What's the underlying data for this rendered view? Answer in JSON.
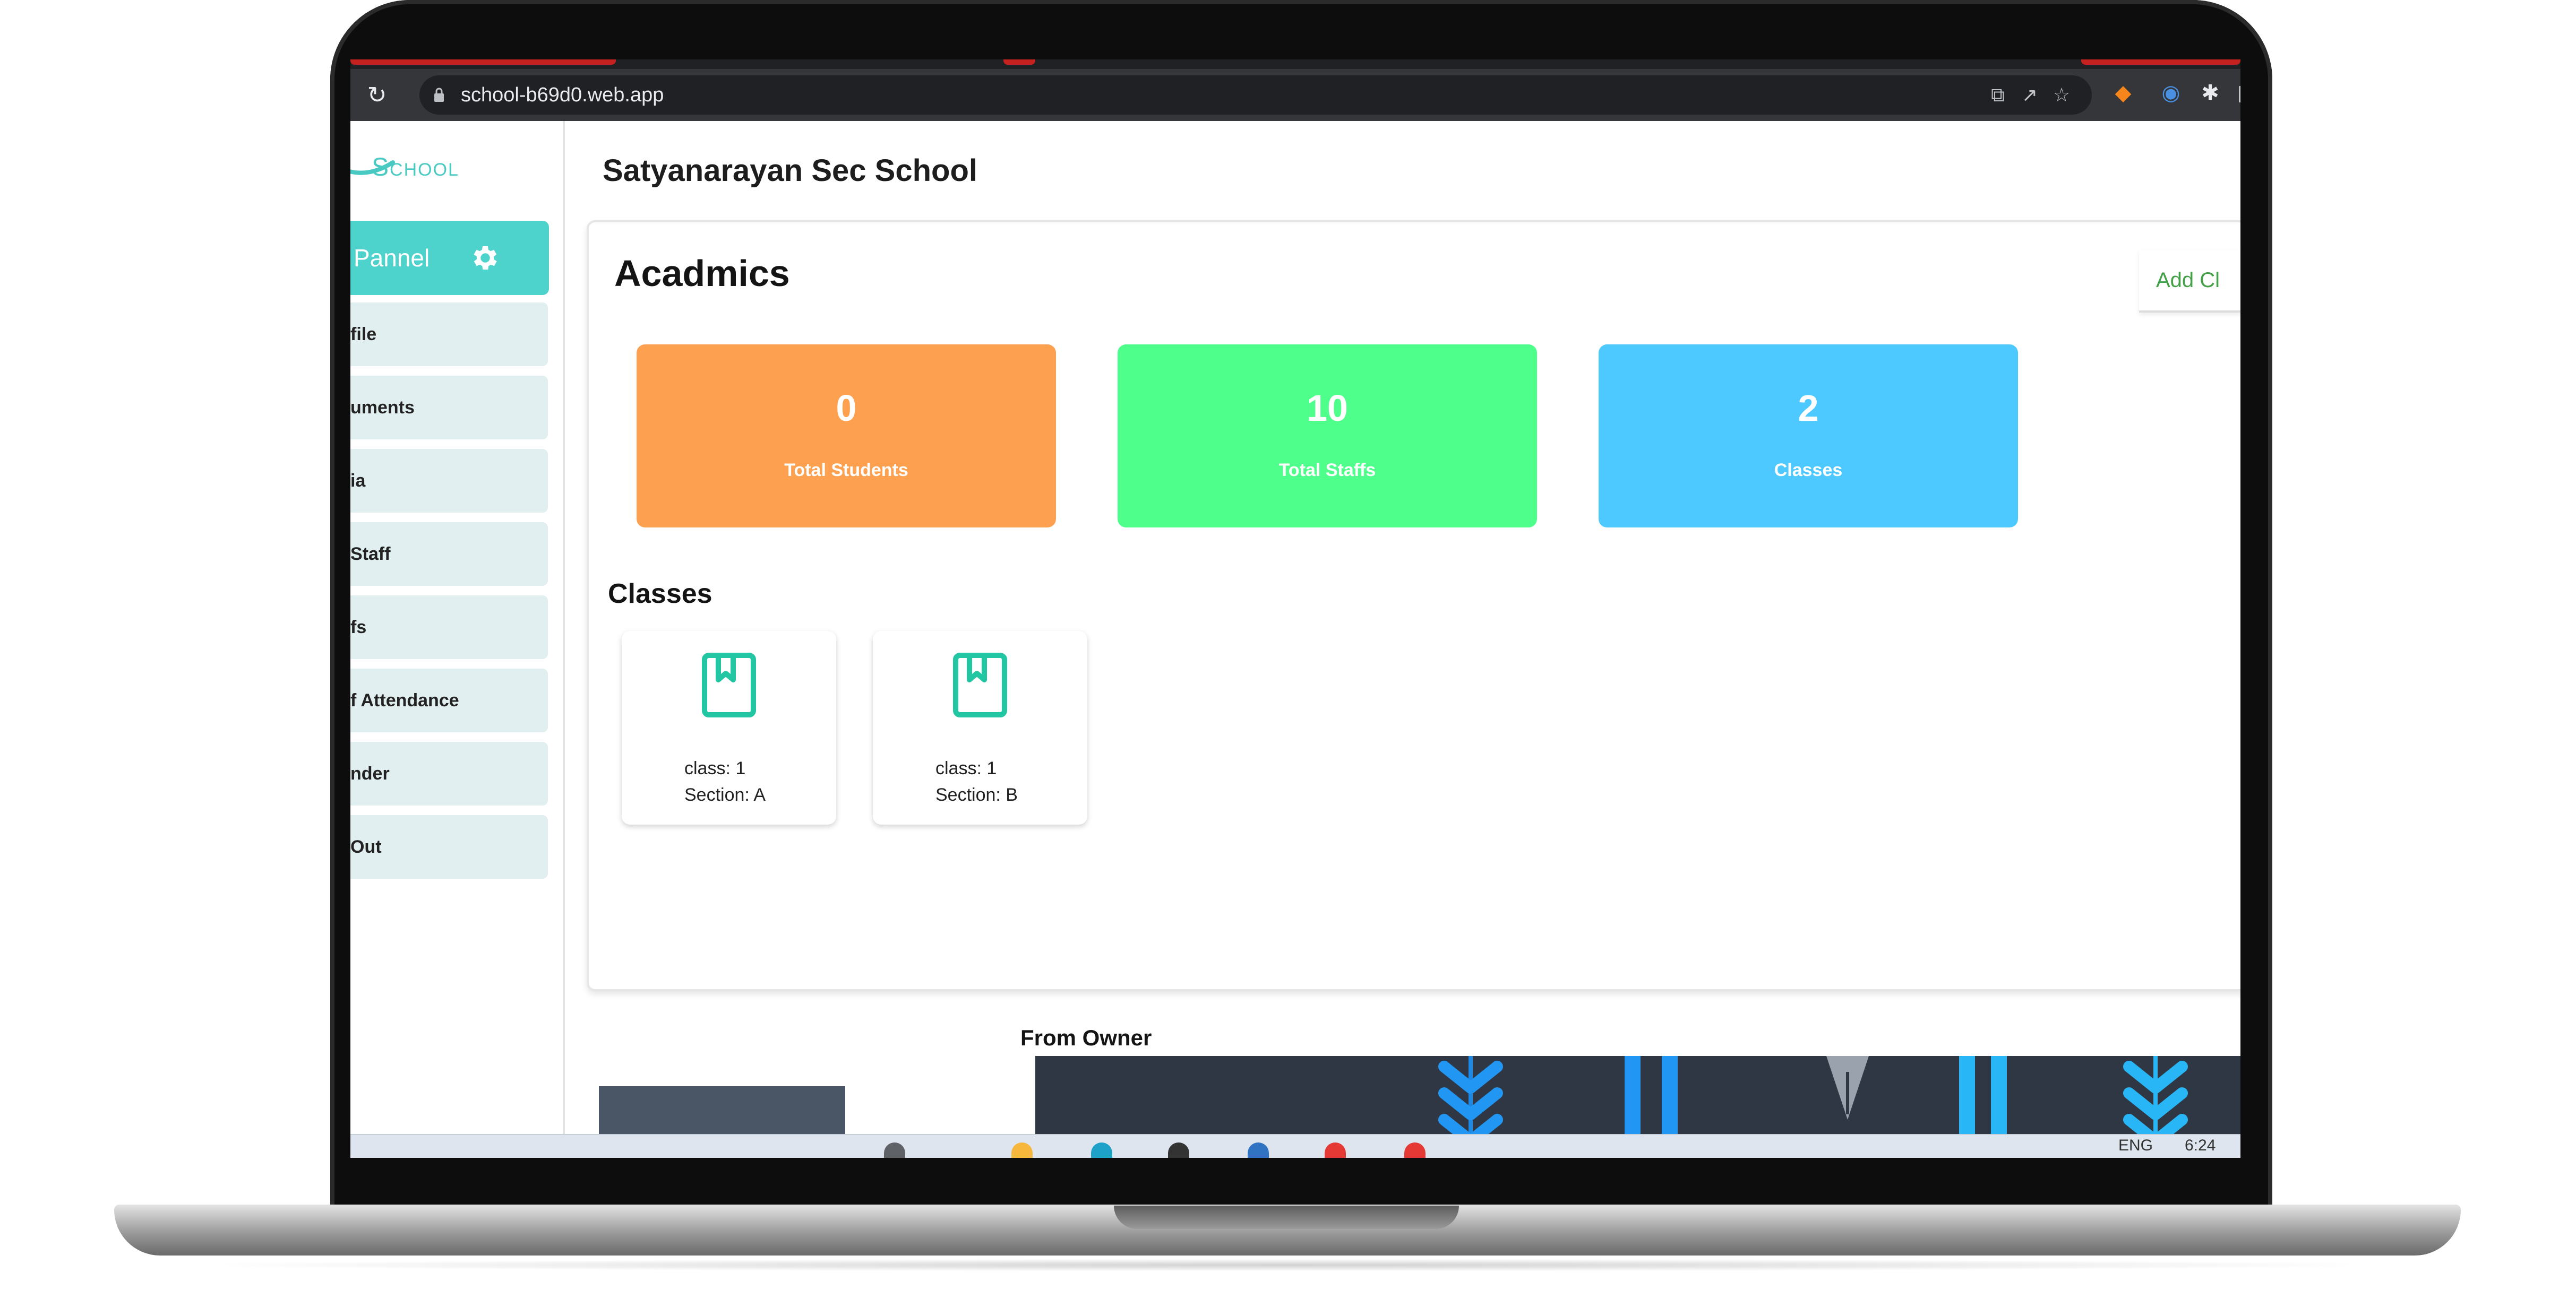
{
  "browser": {
    "url": "school-b69d0.web.app"
  },
  "sidebar": {
    "brand": "School",
    "panel_label": "Pannel",
    "items": [
      {
        "label": "file"
      },
      {
        "label": "uments"
      },
      {
        "label": "ia"
      },
      {
        "label": "Staff"
      },
      {
        "label": "fs"
      },
      {
        "label": "f Attendance"
      },
      {
        "label": "nder"
      },
      {
        "label": "Out"
      }
    ]
  },
  "main": {
    "school_name": "Satyanarayan Sec School",
    "section_title": "Acadmics",
    "add_class_label": "Add Cl",
    "stats": [
      {
        "value": "0",
        "label": "Total Students",
        "color": "#fda04f"
      },
      {
        "value": "10",
        "label": "Total Staffs",
        "color": "#4fff8c"
      },
      {
        "value": "2",
        "label": "Classes",
        "color": "#4dc9ff"
      }
    ],
    "classes_title": "Classes",
    "classes": [
      {
        "class_line": "class: 1",
        "section_line": "Section: A"
      },
      {
        "class_line": "class: 1",
        "section_line": "Section: B"
      }
    ],
    "owner_caption": "From Owner"
  },
  "taskbar": {
    "language": "ENG",
    "time": "6:24 AM"
  },
  "colors": {
    "accent_teal": "#4dd3cc",
    "icon_teal": "#22c6a3",
    "add_class_green": "#43a047"
  }
}
